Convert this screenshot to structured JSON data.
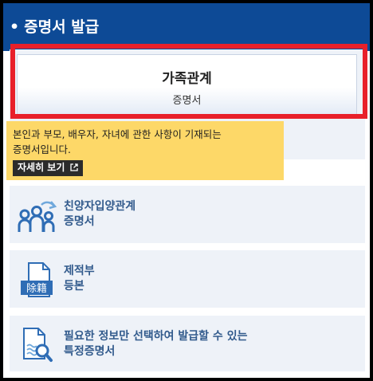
{
  "header": {
    "bullet": "•",
    "title": "증명서 발급"
  },
  "main_card": {
    "title": "가족관계",
    "subtitle": "증명서",
    "tooltip_line1": "본인과 부모, 배우자, 자녀에 관한 사항이 기재되는",
    "tooltip_line2": "증명서입니다.",
    "detail_button": "자세히 보기",
    "detail_icon": "external-link-icon"
  },
  "items": [
    {
      "line1": "친양자입양관계",
      "line2": "증명서",
      "icon": "family-group-icon"
    },
    {
      "line1": "제적부",
      "line2": "등본",
      "icon": "document-removed-register-icon",
      "icon_text": "除籍"
    },
    {
      "line1": "필요한 정보만 선택하여 발급할 수 있는",
      "line2": "특정증명서",
      "icon": "document-search-icon"
    }
  ],
  "colors": {
    "header_bg": "#0d4a96",
    "highlight": "#e8202a",
    "tooltip_bg": "#fdd868",
    "card_bg": "#eef2f8",
    "item_text": "#315a8c"
  }
}
